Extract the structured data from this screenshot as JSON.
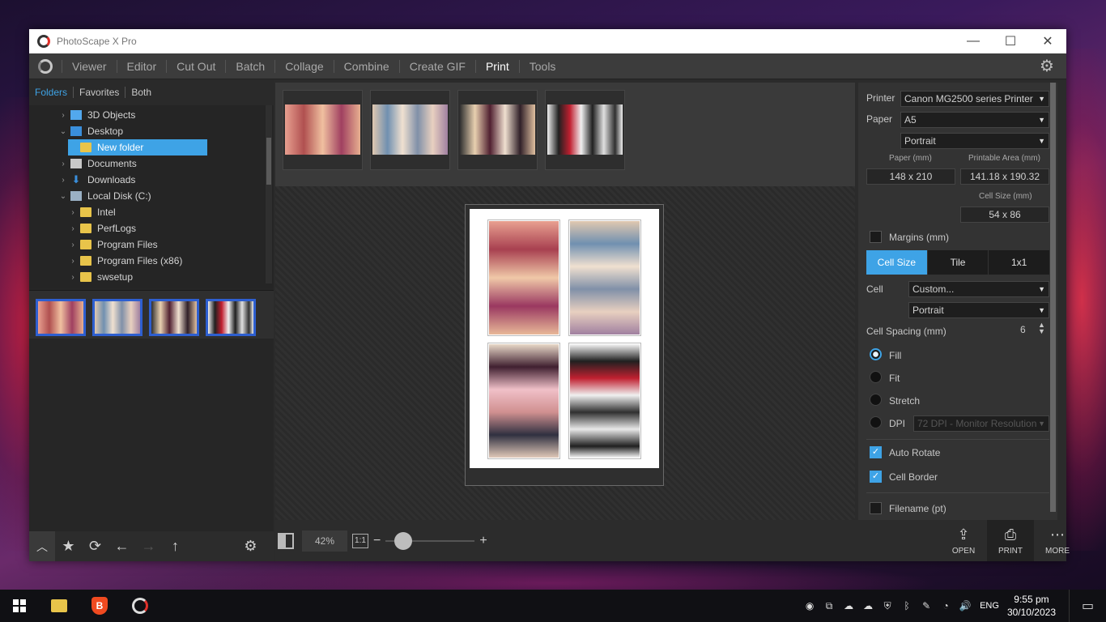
{
  "window": {
    "title": "PhotoScape X Pro",
    "controls": {
      "minimize": "—",
      "maximize": "☐",
      "close": "✕"
    }
  },
  "menu": {
    "items": [
      "Viewer",
      "Editor",
      "Cut Out",
      "Batch",
      "Collage",
      "Combine",
      "Create GIF",
      "Print",
      "Tools"
    ],
    "active": "Print",
    "settings_icon": "gear-icon"
  },
  "left_panel": {
    "tabs": [
      "Folders",
      "Favorites",
      "Both"
    ],
    "active_tab": "Folders",
    "tree": [
      {
        "label": "3D Objects",
        "icon": "cube-icon",
        "level": 0,
        "arrow": "›"
      },
      {
        "label": "Desktop",
        "icon": "desktop-icon",
        "level": 0,
        "arrow": "⌄"
      },
      {
        "label": "New folder",
        "icon": "folder-icon",
        "level": 1,
        "arrow": "",
        "selected": true
      },
      {
        "label": "Documents",
        "icon": "document-icon",
        "level": 0,
        "arrow": "›"
      },
      {
        "label": "Downloads",
        "icon": "download-icon",
        "level": 0,
        "arrow": "›"
      },
      {
        "label": "Local Disk (C:)",
        "icon": "disk-icon",
        "level": 0,
        "arrow": "⌄"
      },
      {
        "label": "Intel",
        "icon": "folder-icon",
        "level": 1,
        "arrow": "›"
      },
      {
        "label": "PerfLogs",
        "icon": "folder-icon",
        "level": 1,
        "arrow": "›"
      },
      {
        "label": "Program Files",
        "icon": "folder-icon",
        "level": 1,
        "arrow": "›"
      },
      {
        "label": "Program Files (x86)",
        "icon": "folder-icon",
        "level": 1,
        "arrow": "›"
      },
      {
        "label": "swsetup",
        "icon": "folder-icon",
        "level": 1,
        "arrow": "›"
      }
    ],
    "bottom_icons": [
      "chevron-up-icon",
      "star-icon",
      "refresh-icon",
      "back-arrow-icon",
      "forward-arrow-icon",
      "up-arrow-icon",
      "gear-icon"
    ]
  },
  "viewer": {
    "zoom": "42%",
    "actual_size": "1:1",
    "zoom_fraction": 0.1
  },
  "settings": {
    "printer_label": "Printer",
    "printer": "Canon MG2500 series Printer",
    "paper_label": "Paper",
    "paper": "A5",
    "orientation": "Portrait",
    "paper_mm_label": "Paper (mm)",
    "printable_label": "Printable Area (mm)",
    "paper_mm": "148 x 210",
    "printable": "141.18 x 190.32",
    "cell_size_label": "Cell Size (mm)",
    "cell_size": "54 x 86",
    "margins_label": "Margins (mm)",
    "margins_checked": false,
    "layout_tabs": [
      "Cell Size",
      "Tile",
      "1x1"
    ],
    "active_layout_tab": "Cell Size",
    "cell_label": "Cell",
    "cell": "Custom...",
    "cell_orientation": "Portrait",
    "spacing_label": "Cell Spacing (mm)",
    "spacing": "6",
    "fit_options": [
      "Fill",
      "Fit",
      "Stretch",
      "DPI"
    ],
    "fit_selected": "Fill",
    "dpi": "72 DPI - Monitor Resolution",
    "auto_rotate_label": "Auto Rotate",
    "auto_rotate": true,
    "cell_border_label": "Cell Border",
    "cell_border": true,
    "filename_label": "Filename (pt)",
    "filename": false
  },
  "actions": {
    "open": "OPEN",
    "print": "PRINT",
    "more": "MORE"
  },
  "taskbar": {
    "language": "ENG",
    "time": "9:55 pm",
    "date": "30/10/2023"
  }
}
